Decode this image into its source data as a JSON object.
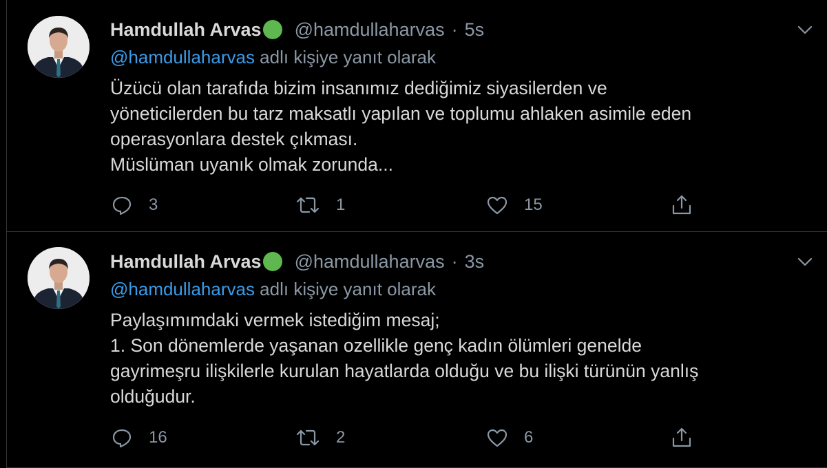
{
  "tweets": [
    {
      "display_name": "Hamdullah Arvas",
      "handle": "@hamdullaharvas",
      "separator": "·",
      "time": "5s",
      "reply_to": "@hamdullaharvas",
      "reply_suffix": " adlı kişiye yanıt olarak",
      "body_lines": [
        "Üzücü olan tarafıda bizim insanımız dediğimiz siyasilerden ve",
        "yöneticilerden bu tarz maksatlı yapılan ve toplumu ahlaken asimile eden",
        "operasyonlara destek çıkması.",
        "Müslüman uyanık olmak zorunda..."
      ],
      "replies": "3",
      "retweets": "1",
      "likes": "15"
    },
    {
      "display_name": "Hamdullah Arvas",
      "handle": "@hamdullaharvas",
      "separator": "·",
      "time": "3s",
      "reply_to": "@hamdullaharvas",
      "reply_suffix": " adlı kişiye yanıt olarak",
      "body_lines": [
        "Paylaşımımdaki vermek istediğim mesaj;",
        "1. Son dönemlerde yaşanan ozellikle genç kadın ölümleri genelde",
        "gayrimeşru ilişkilerle kurulan hayatlarda olduğu ve bu ilişki türünün yanlış",
        "olduğudur."
      ],
      "replies": "16",
      "retweets": "2",
      "likes": "6"
    }
  ],
  "icons": {
    "verified": "green-circle-emoji",
    "menu": "chevron-down-icon",
    "reply": "reply-icon",
    "retweet": "retweet-icon",
    "like": "heart-icon",
    "share": "share-icon"
  },
  "colors": {
    "background": "#000000",
    "text": "#d9d9d9",
    "muted": "#8b98a5",
    "link": "#3a9be9",
    "border": "#2f3336",
    "verified": "#5fb84f"
  }
}
